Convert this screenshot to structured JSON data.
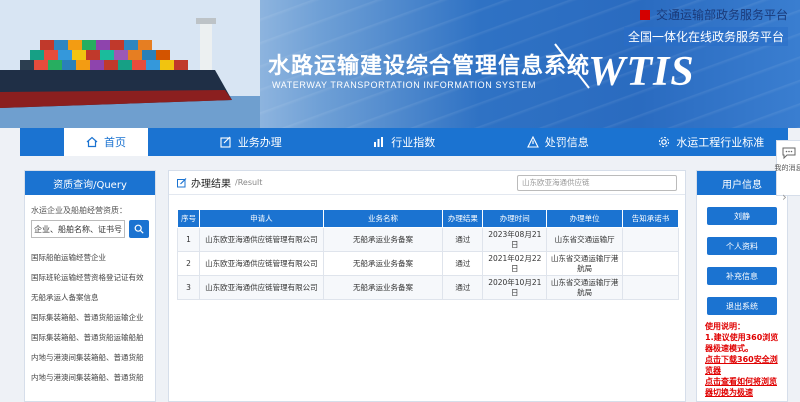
{
  "header": {
    "portal_link": "交通运输部政务服务平台",
    "portal_sub": "全国一体化在线政务服务平台",
    "system_title": "水路运输建设综合管理信息系统",
    "system_subtitle": "WATERWAY TRANSPORTATION INFORMATION SYSTEM",
    "logo": "WTIS"
  },
  "nav": {
    "items": [
      {
        "label": "首页",
        "icon": "home-icon"
      },
      {
        "label": "业务办理",
        "icon": "edit-icon"
      },
      {
        "label": "行业指数",
        "icon": "bar-chart-icon"
      },
      {
        "label": "处罚信息",
        "icon": "warning-icon"
      },
      {
        "label": "水运工程行业标准",
        "icon": "settings-icon"
      }
    ]
  },
  "left": {
    "title": "资质查询/Query",
    "label": "水运企业及船舶经营资质：",
    "search_value": "企业、船舶名称、证书号（",
    "links": [
      "国际船舶运输经营企业",
      "国际班轮运输经营资格登记证有效",
      "无船承运人备案信息",
      "国际集装箱船、普通货船运输企业",
      "国际集装箱船、普通货船运输船舶",
      "内地与港澳间集装箱船、普通货船",
      "内地与港澳间集装箱船、普通货船"
    ]
  },
  "main": {
    "title": "办理结果",
    "subtitle": "/Result",
    "search_value": "山东欧亚海通供应链",
    "columns": [
      "序号",
      "申请人",
      "业务名称",
      "办理结果",
      "办理时间",
      "办理单位",
      "告知承诺书"
    ],
    "rows": [
      [
        "1",
        "山东欧亚海通供应链管理有限公司",
        "无船承运业务备案",
        "通过",
        "2023年08月21日",
        "山东省交通运输厅",
        ""
      ],
      [
        "2",
        "山东欧亚海通供应链管理有限公司",
        "无船承运业务备案",
        "通过",
        "2021年02月22日",
        "山东省交通运输厅港航局",
        ""
      ],
      [
        "3",
        "山东欧亚海通供应链管理有限公司",
        "无船承运业务备案",
        "通过",
        "2020年10月21日",
        "山东省交通运输厅港航局",
        ""
      ]
    ]
  },
  "right": {
    "title": "用户信息",
    "username": "刘静",
    "buttons": [
      "个人资料",
      "补充信息",
      "退出系统"
    ],
    "notes_title": "使用说明：",
    "notes": [
      "1.建议使用360浏览器极速模式。",
      "点击下载360安全浏览器",
      "点击查看如何将浏览器切换为极速"
    ]
  },
  "float_widget": {
    "label": "我的消息"
  },
  "colors": {
    "primary": "#1b73d1",
    "alert": "#e00000"
  }
}
